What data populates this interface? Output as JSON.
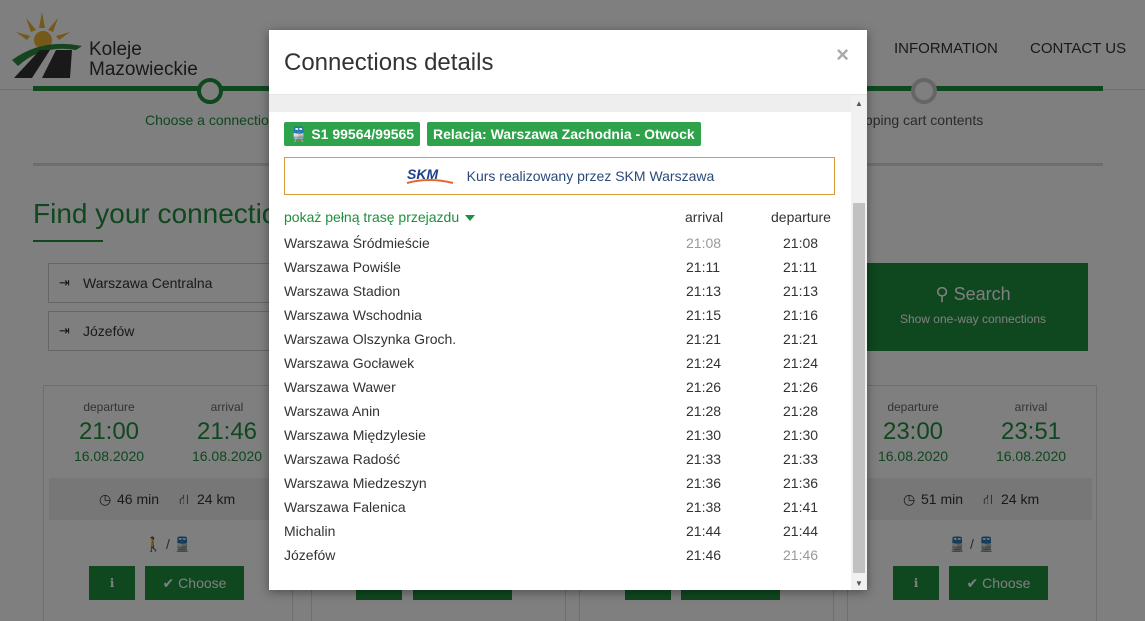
{
  "header": {
    "logo_line1": "Koleje",
    "logo_line2": "Mazowieckie",
    "nav": [
      "INFORMATION",
      "CONTACT US"
    ]
  },
  "steps": {
    "step1_label": "Choose a connection",
    "step3_label": "Shopping cart contents"
  },
  "search": {
    "title": "Find your connection",
    "from_value": "Warszawa Centralna",
    "to_value": "Józefów",
    "button_label": "Search",
    "button_sub": "Show one-way connections"
  },
  "cards": [
    {
      "dep_label": "departure",
      "arr_label": "arrival",
      "dep_time": "21:00",
      "arr_time": "21:46",
      "dep_date": "16.08.2020",
      "arr_date": "16.08.2020",
      "duration": "46 min",
      "distance": "24 km",
      "mode": "🚶 / 🚆",
      "choose": "Choose"
    },
    {
      "dep_label": "departure",
      "arr_label": "arrival",
      "dep_time": "23:00",
      "arr_time": "23:51",
      "dep_date": "16.08.2020",
      "arr_date": "16.08.2020",
      "duration": "51 min",
      "distance": "24 km",
      "mode": "🚆 / 🚆",
      "choose": "Choose"
    }
  ],
  "modal": {
    "title": "Connections details",
    "close": "×",
    "train_number": "S1 99564/99565",
    "relation": "Relacja: Warszawa Zachodnia - Otwock",
    "operator_logo": "SKM",
    "operator_text": "Kurs realizowany przez SKM Warszawa",
    "route_toggle": "pokaż pełną trasę przejazdu",
    "arrival_header": "arrival",
    "departure_header": "departure",
    "stops": [
      {
        "name": "Warszawa Śródmieście",
        "arrival": "21:08",
        "departure": "21:08",
        "arr_muted": true,
        "dep_muted": false
      },
      {
        "name": "Warszawa Powiśle",
        "arrival": "21:11",
        "departure": "21:11",
        "arr_muted": false,
        "dep_muted": false
      },
      {
        "name": "Warszawa Stadion",
        "arrival": "21:13",
        "departure": "21:13",
        "arr_muted": false,
        "dep_muted": false
      },
      {
        "name": "Warszawa Wschodnia",
        "arrival": "21:15",
        "departure": "21:16",
        "arr_muted": false,
        "dep_muted": false
      },
      {
        "name": "Warszawa Olszynka Groch.",
        "arrival": "21:21",
        "departure": "21:21",
        "arr_muted": false,
        "dep_muted": false
      },
      {
        "name": "Warszawa Gocławek",
        "arrival": "21:24",
        "departure": "21:24",
        "arr_muted": false,
        "dep_muted": false
      },
      {
        "name": "Warszawa Wawer",
        "arrival": "21:26",
        "departure": "21:26",
        "arr_muted": false,
        "dep_muted": false
      },
      {
        "name": "Warszawa Anin",
        "arrival": "21:28",
        "departure": "21:28",
        "arr_muted": false,
        "dep_muted": false
      },
      {
        "name": "Warszawa Międzylesie",
        "arrival": "21:30",
        "departure": "21:30",
        "arr_muted": false,
        "dep_muted": false
      },
      {
        "name": "Warszawa Radość",
        "arrival": "21:33",
        "departure": "21:33",
        "arr_muted": false,
        "dep_muted": false
      },
      {
        "name": "Warszawa Miedzeszyn",
        "arrival": "21:36",
        "departure": "21:36",
        "arr_muted": false,
        "dep_muted": false
      },
      {
        "name": "Warszawa Falenica",
        "arrival": "21:38",
        "departure": "21:41",
        "arr_muted": false,
        "dep_muted": false
      },
      {
        "name": "Michalin",
        "arrival": "21:44",
        "departure": "21:44",
        "arr_muted": false,
        "dep_muted": false
      },
      {
        "name": "Józefów",
        "arrival": "21:46",
        "departure": "21:46",
        "arr_muted": false,
        "dep_muted": true
      }
    ]
  },
  "colors": {
    "brand_green": "#1e8f3e",
    "badge_green": "#2ea34b",
    "operator_border": "#d89a3a"
  }
}
